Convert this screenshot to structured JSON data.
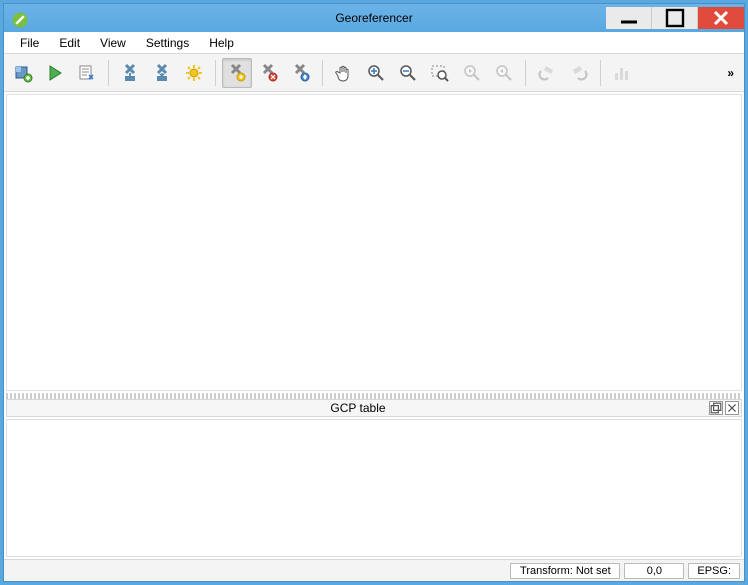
{
  "window": {
    "title": "Georeferencer"
  },
  "menu": {
    "file": "File",
    "edit": "Edit",
    "view": "View",
    "settings": "Settings",
    "help": "Help"
  },
  "toolbar": {
    "open_raster": "Open Raster",
    "start": "Start Georeferencing",
    "generate_script": "Generate GDAL Script",
    "load_gcp": "Load GCP Points",
    "save_gcp": "Save GCP Points",
    "transform_settings": "Transformation Settings",
    "add_point": "Add Point",
    "delete_point": "Delete Point",
    "move_point": "Move GCP Point",
    "pan": "Pan",
    "zoom_in": "Zoom In",
    "zoom_out": "Zoom Out",
    "zoom_layer": "Zoom to Layer",
    "zoom_last": "Zoom Last",
    "zoom_next": "Zoom Next",
    "link_georef": "Link Georeferencer to QGIS",
    "link_qgis": "Link QGIS to Georeferencer",
    "histogram": "Full Histogram Stretch",
    "overflow": "»"
  },
  "panels": {
    "gcp_table": "GCP table"
  },
  "status": {
    "transform": "Transform: Not set",
    "coords": "0,0",
    "epsg": "EPSG:"
  }
}
